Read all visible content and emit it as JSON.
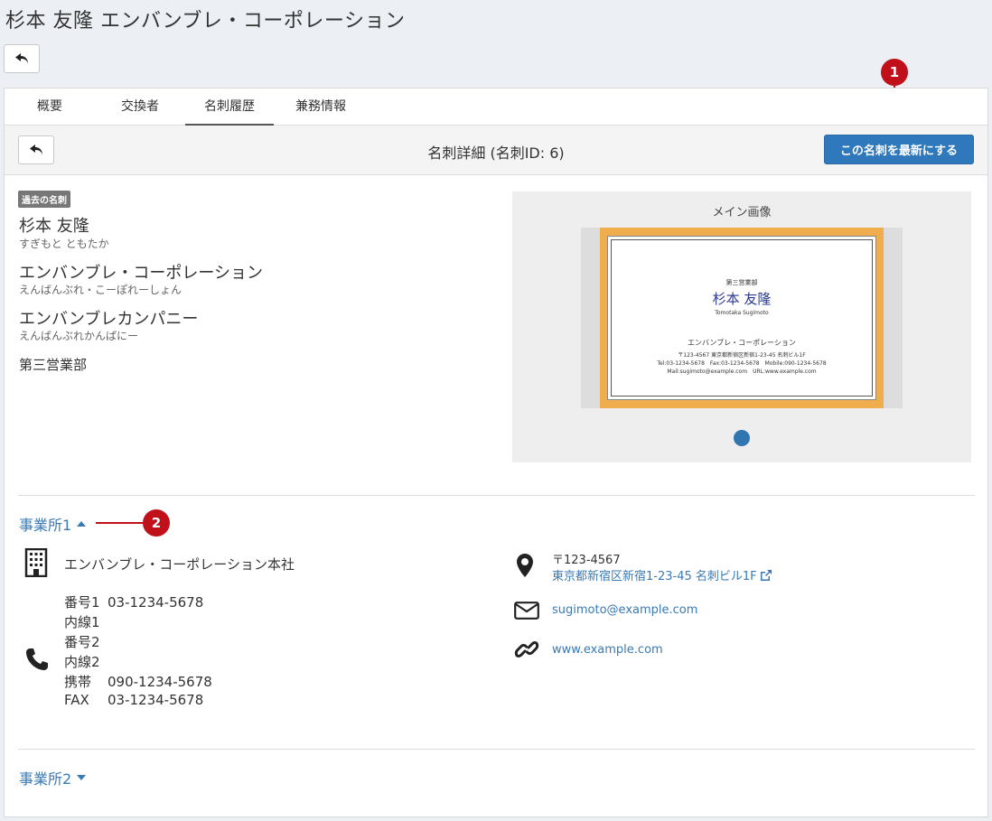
{
  "page": {
    "title": "杉本 友隆 エンバンブレ・コーポレーション"
  },
  "tabs": [
    {
      "label": "概要"
    },
    {
      "label": "交換者"
    },
    {
      "label": "名刺履歴"
    },
    {
      "label": "兼務情報"
    }
  ],
  "detail": {
    "title": "名刺詳細 (名刺ID: 6)",
    "latest_button": "この名刺を最新にする",
    "badge": "過去の名刺",
    "person_name": "杉本 友隆",
    "person_kana": "すぎもと ともたか",
    "company": "エンバンブレ・コーポレーション",
    "company_kana": "えんばんぶれ・こーぽれーしょん",
    "company_en": "エンバンブレカンパニー",
    "company_en_kana": "えんばんぶれかんぱにー",
    "department": "第三営業部"
  },
  "image": {
    "label": "メイン画像",
    "card": {
      "dept": "第三営業部",
      "name": "杉本 友隆",
      "romaji": "Tomotaka Sugimoto",
      "company": "エンバンブレ・コーポレーション",
      "address": "〒123-4567 東京都新宿区新宿1-23-45 名刺ビル1F",
      "tel_line": "Tel:03-1234-5678　Fax:03-1234-5678　Mobile:090-1234-5678",
      "mail_line": "Mail:sugimoto@example.com　URL:www.example.com"
    }
  },
  "callouts": {
    "one": "1",
    "two": "2"
  },
  "office1": {
    "toggle_label": "事業所1",
    "name": "エンバンブレ・コーポレーション本社",
    "phones": [
      {
        "label": "番号1",
        "value": "03-1234-5678"
      },
      {
        "label": "内線1",
        "value": ""
      },
      {
        "label": "番号2",
        "value": ""
      },
      {
        "label": "内線2",
        "value": ""
      },
      {
        "label": "携帯",
        "value": "090-1234-5678"
      },
      {
        "label": "FAX",
        "value": "03-1234-5678"
      }
    ],
    "postal": "〒123-4567",
    "address": "東京都新宿区新宿1-23-45 名刺ビル1F",
    "email": "sugimoto@example.com",
    "url": "www.example.com"
  },
  "office2": {
    "toggle_label": "事業所2"
  }
}
